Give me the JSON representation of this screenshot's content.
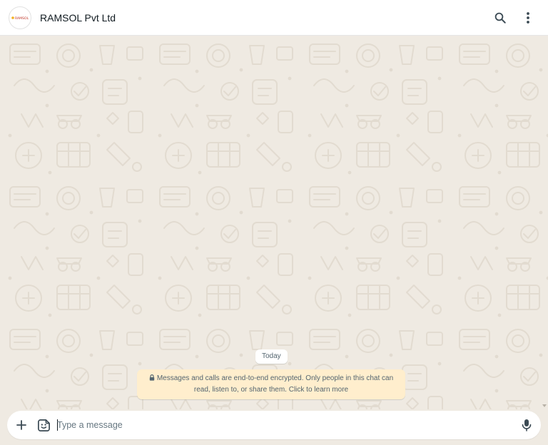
{
  "header": {
    "contact_name": "RAMSOL Pvt Ltd",
    "avatar_logo_text": "RAMSOL",
    "icons": [
      "search-icon",
      "more-vertical-icon"
    ]
  },
  "chat": {
    "date_chip": "Today",
    "encryption_notice": "Messages and calls are end-to-end encrypted. Only people in this chat can read, listen to, or share them. Click to learn more",
    "icons": [
      "lock-icon",
      "scroll-down-arrow-icon"
    ]
  },
  "composer": {
    "placeholder": "Type a message",
    "value": "",
    "icons": [
      "plus-icon",
      "sticker-icon",
      "microphone-icon"
    ]
  },
  "colors": {
    "header_bg": "#ffffff",
    "chat_bg": "#efeae2",
    "doodle": "#e3ddd3",
    "notice_bg": "#ffeecd",
    "icon": "#3b4a54",
    "text_primary": "#111b21",
    "text_secondary": "#54656f"
  }
}
